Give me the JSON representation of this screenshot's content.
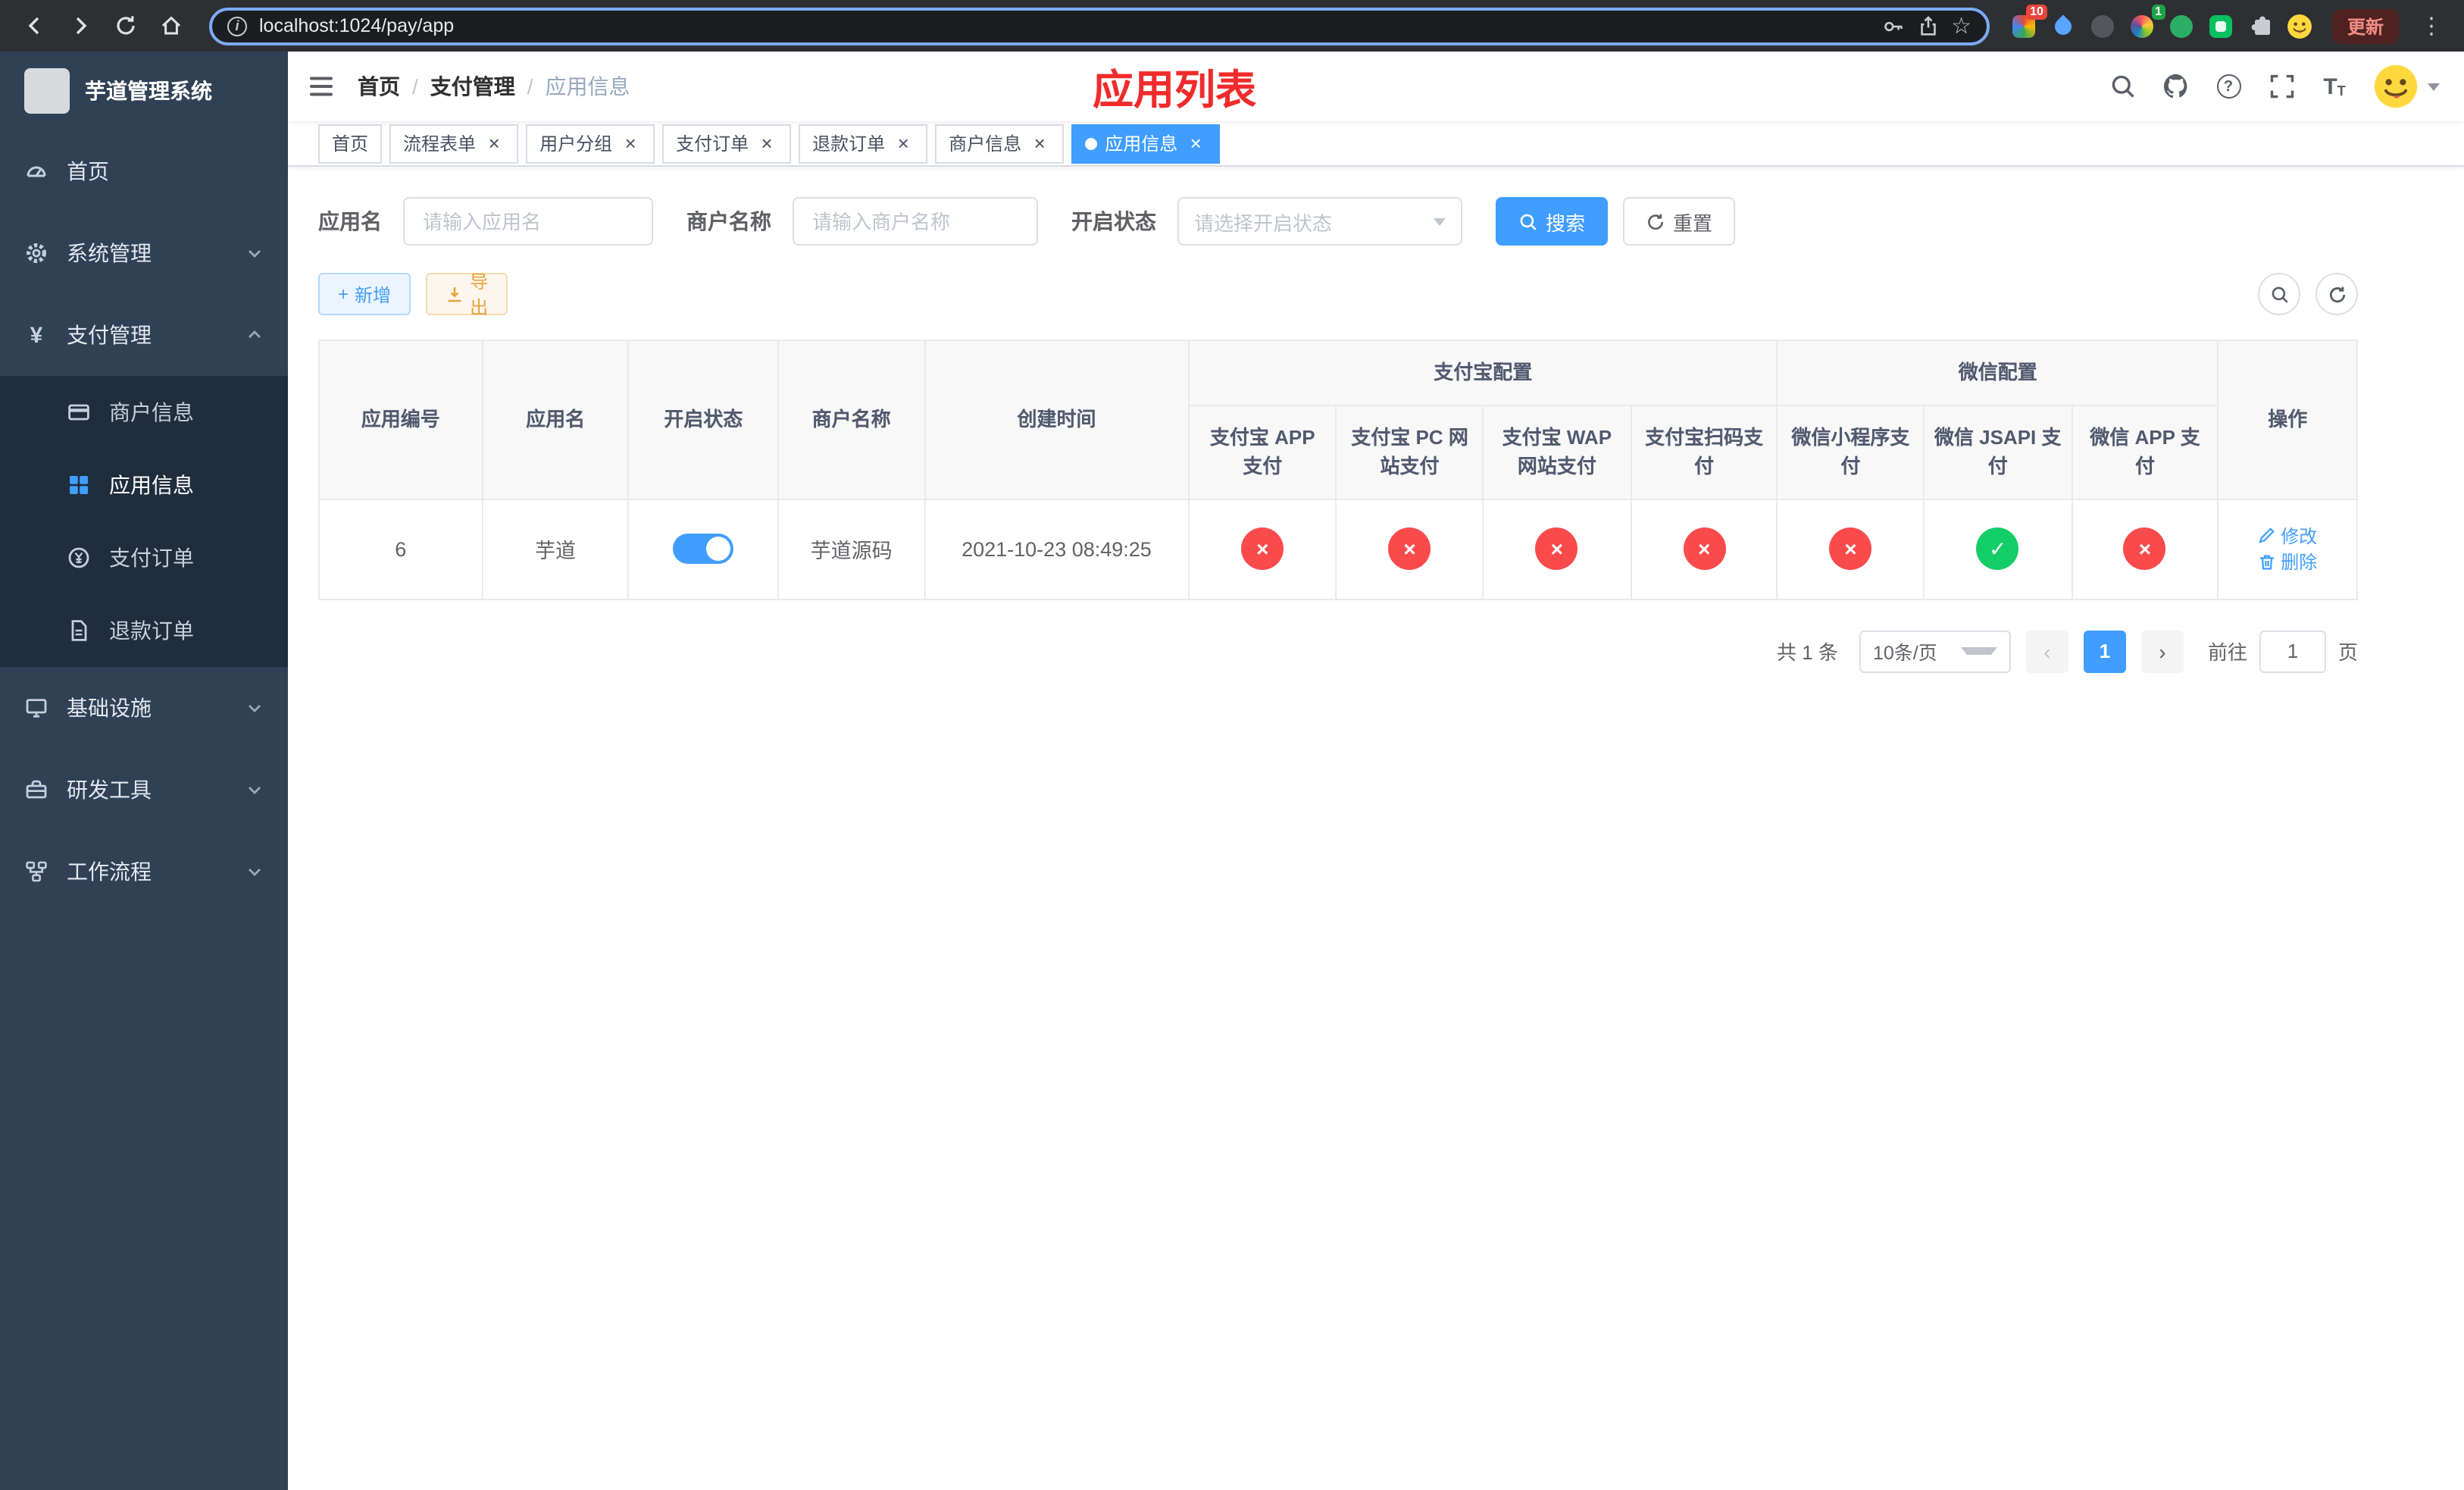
{
  "colors": {
    "primary": "#409eff",
    "success": "#13ce66",
    "danger": "#fa4b4c",
    "warning": "#e6a23c",
    "title_red": "#f12b2b",
    "sidebar_bg": "#304156",
    "submenu_bg": "#1f2d3d"
  },
  "browser": {
    "url": "localhost:1024/pay/app",
    "update_label": "更新",
    "ext_badge_red": "10",
    "ext_badge_green": "1"
  },
  "sidebar": {
    "logo_title": "芋道管理系统",
    "items": [
      {
        "label": "首页"
      },
      {
        "label": "系统管理"
      },
      {
        "label": "支付管理"
      },
      {
        "label": "基础设施"
      },
      {
        "label": "研发工具"
      },
      {
        "label": "工作流程"
      }
    ],
    "payment_children": [
      {
        "label": "商户信息"
      },
      {
        "label": "应用信息"
      },
      {
        "label": "支付订单"
      },
      {
        "label": "退款订单"
      }
    ]
  },
  "header": {
    "breadcrumb": [
      "首页",
      "支付管理",
      "应用信息"
    ],
    "page_title": "应用列表"
  },
  "tabs": [
    {
      "label": "首页"
    },
    {
      "label": "流程表单"
    },
    {
      "label": "用户分组"
    },
    {
      "label": "支付订单"
    },
    {
      "label": "退款订单"
    },
    {
      "label": "商户信息"
    },
    {
      "label": "应用信息"
    }
  ],
  "filters": {
    "app_name_label": "应用名",
    "app_name_placeholder": "请输入应用名",
    "merchant_label": "商户名称",
    "merchant_placeholder": "请输入商户名称",
    "status_label": "开启状态",
    "status_placeholder": "请选择开启状态",
    "search_label": "搜索",
    "reset_label": "重置"
  },
  "toolbar": {
    "add_label": "新增",
    "export_label": "导出"
  },
  "table": {
    "columns": {
      "app_id": "应用编号",
      "app_name": "应用名",
      "status": "开启状态",
      "merchant": "商户名称",
      "created": "创建时间",
      "group_alipay": "支付宝配置",
      "group_wechat": "微信配置",
      "alipay_app": "支付宝 APP 支付",
      "alipay_pc": "支付宝 PC 网站支付",
      "alipay_wap": "支付宝 WAP 网站支付",
      "alipay_qr": "支付宝扫码支付",
      "wx_mini": "微信小程序支付",
      "wx_jsapi": "微信 JSAPI 支付",
      "wx_app": "微信 APP 支付",
      "actions": "操作"
    },
    "row": {
      "app_id": "6",
      "app_name": "芋道",
      "status_on": true,
      "merchant": "芋道源码",
      "created": "2021-10-23 08:49:25",
      "statuses": [
        "fail",
        "fail",
        "fail",
        "fail",
        "fail",
        "success",
        "fail"
      ],
      "edit_label": "修改",
      "delete_label": "删除"
    }
  },
  "pagination": {
    "total_text": "共 1 条",
    "page_size": "10条/页",
    "current_page": "1",
    "goto_label": "前往",
    "goto_value": "1",
    "page_unit": "页"
  }
}
